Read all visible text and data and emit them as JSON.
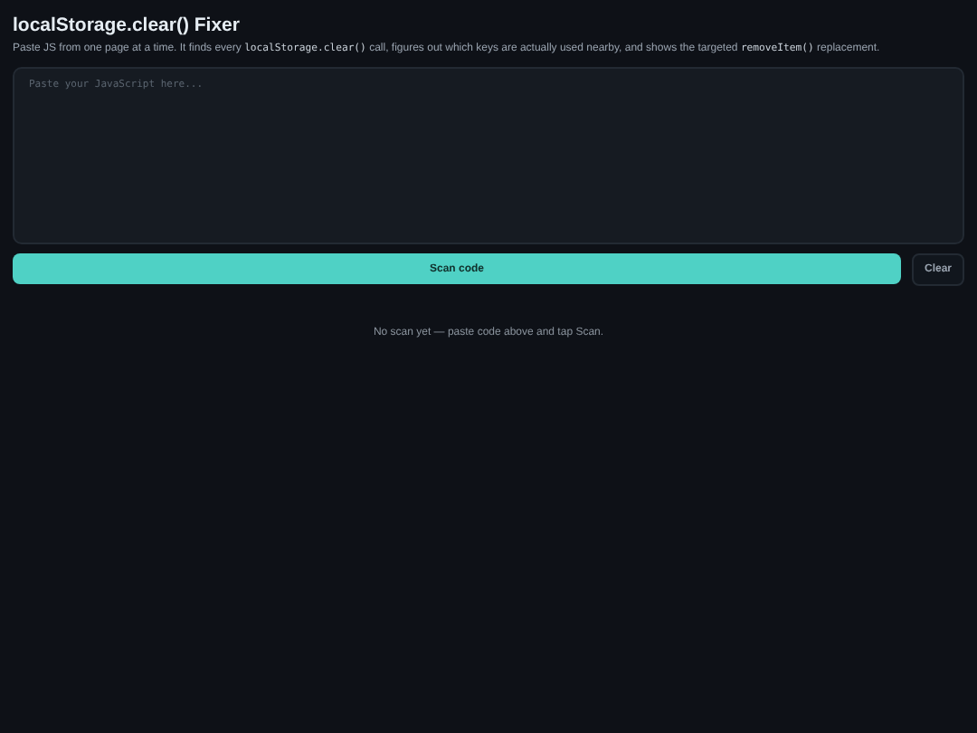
{
  "title": "localStorage.clear() Fixer",
  "description": [
    {
      "kind": "text",
      "text": "Paste JS from one page at a time. It finds every "
    },
    {
      "kind": "code",
      "text": "localStorage.clear()"
    },
    {
      "kind": "text",
      "text": " call, figures out which keys are actually used nearby, and shows the targeted "
    },
    {
      "kind": "code",
      "text": "removeItem()"
    },
    {
      "kind": "text",
      "text": " replacement."
    }
  ],
  "editor": {
    "placeholder": "Paste your JavaScript here..."
  },
  "buttons": {
    "scan": "Scan code",
    "clear": "Clear"
  },
  "status": "No scan yet — paste code above and tap Scan."
}
